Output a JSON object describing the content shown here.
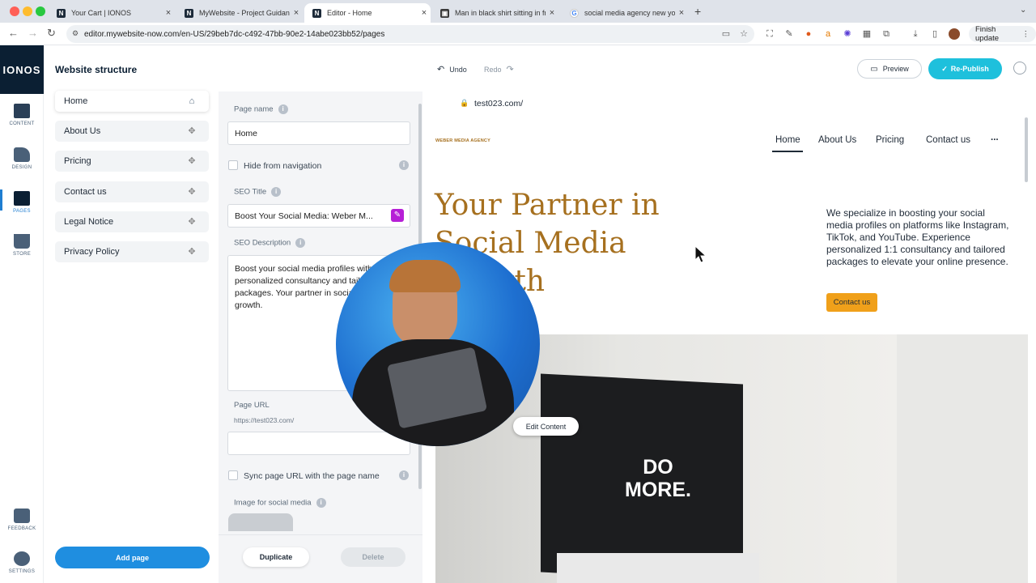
{
  "browser": {
    "tabs": [
      {
        "title": "Your Cart | IONOS",
        "active": false
      },
      {
        "title": "MyWebsite - Project Guidanc",
        "active": false
      },
      {
        "title": "Editor - Home",
        "active": true
      },
      {
        "title": "Man in black shirt sitting in fr",
        "active": false
      },
      {
        "title": "social media agency new yor",
        "active": false
      }
    ],
    "url": "editor.mywebsite-now.com/en-US/29beb7dc-c492-47bb-90e2-14abe023bb52/pages",
    "finish_update": "Finish update",
    "colors": {
      "tabbar": "#dfe3ea"
    }
  },
  "rail": {
    "logo": "IONOS",
    "items": [
      {
        "label": "CONTENT",
        "icon": "content-icon"
      },
      {
        "label": "DESIGN",
        "icon": "design-icon"
      },
      {
        "label": "PAGES",
        "icon": "pages-icon",
        "active": true
      },
      {
        "label": "STORE",
        "icon": "store-icon"
      },
      {
        "label": "FEEDBACK",
        "icon": "feedback-icon"
      },
      {
        "label": "SETTINGS",
        "icon": "settings-icon"
      }
    ]
  },
  "structure": {
    "title": "Website structure",
    "pages": [
      {
        "label": "Home",
        "icon": "home-icon",
        "selected": true
      },
      {
        "label": "About Us",
        "icon": "drag-handle-icon"
      },
      {
        "label": "Pricing",
        "icon": "drag-handle-icon"
      },
      {
        "label": "Contact us",
        "icon": "drag-handle-icon"
      },
      {
        "label": "Legal Notice",
        "icon": "drag-handle-icon"
      },
      {
        "label": "Privacy Policy",
        "icon": "drag-handle-icon"
      }
    ],
    "add_page": "Add page"
  },
  "settings": {
    "page_name_label": "Page name",
    "page_name_value": "Home",
    "hide_nav": "Hide from navigation",
    "seo_title_label": "SEO Title",
    "seo_title_value": "Boost Your Social Media: Weber M...",
    "seo_desc_label": "SEO Description",
    "seo_desc_value": "Boost your social media profiles with personalized consultancy and tailored packages. Your partner in social media growth.",
    "page_url_label": "Page URL",
    "page_url_prefix": "https://test023.com/",
    "page_url_value": "",
    "sync_url": "Sync page URL with the page name",
    "social_image_label": "Image for social media",
    "duplicate": "Duplicate",
    "delete": "Delete"
  },
  "header": {
    "undo": "Undo",
    "redo": "Redo",
    "preview": "Preview",
    "republish": "Re-Publish"
  },
  "site": {
    "domain": "test023.com/",
    "brand": "WEBER MEDIA AGENCY",
    "nav": [
      "Home",
      "About Us",
      "Pricing",
      "Contact us",
      "..."
    ],
    "headline": "Your Partner in Social Media Growth",
    "intro": "We specialize in boosting your social media profiles on platforms like Instagram, TikTok, and YouTube. Experience personalized 1:1 consultancy and tailored packages to elevate your online presence.",
    "cta": "Contact us",
    "hero_text": "DO MORE.",
    "edit_content": "Edit Content",
    "accent": "#a6701f",
    "cta_color": "#f0a01a"
  }
}
